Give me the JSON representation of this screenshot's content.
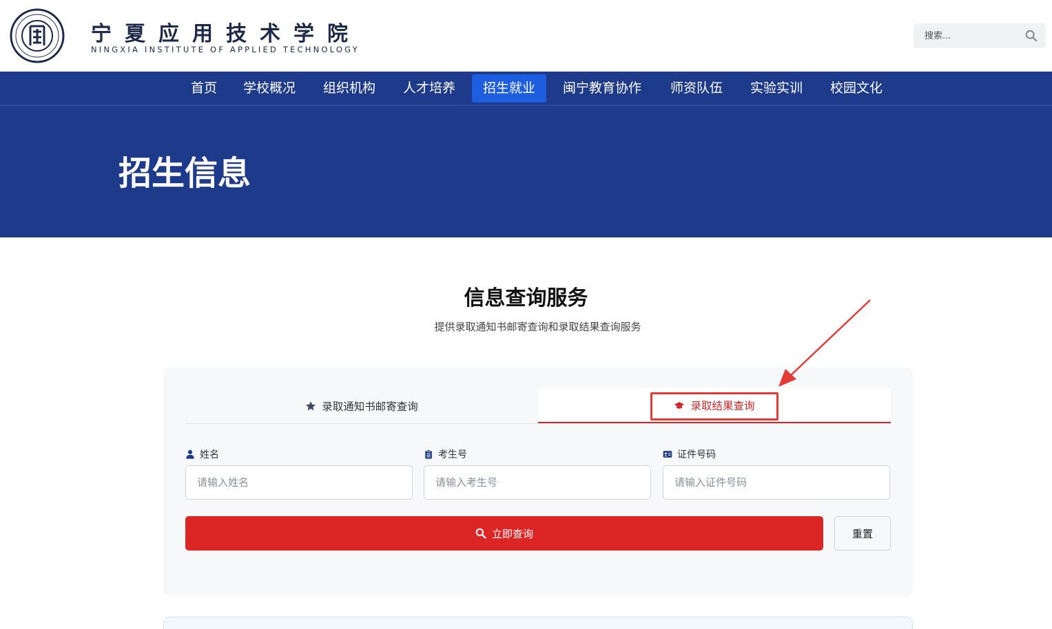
{
  "header": {
    "school_name": "宁夏应用技术学院",
    "school_name_en": "NINGXIA INSTITUTE OF APPLIED TECHNOLOGY",
    "logo_icon": "school-seal-logo",
    "search": {
      "placeholder": "搜索...",
      "icon": "search-icon"
    }
  },
  "nav": {
    "items": [
      {
        "label": "首页"
      },
      {
        "label": "学校概况"
      },
      {
        "label": "组织机构"
      },
      {
        "label": "人才培养"
      },
      {
        "label": "招生就业",
        "active": true
      },
      {
        "label": "闽宁教育协作"
      },
      {
        "label": "师资队伍"
      },
      {
        "label": "实验实训"
      },
      {
        "label": "校园文化"
      }
    ]
  },
  "banner": {
    "title": "招生信息"
  },
  "section": {
    "title": "信息查询服务",
    "subtitle": "提供录取通知书邮寄查询和录取结果查询服务"
  },
  "tabs": [
    {
      "label": "录取通知书邮寄查询",
      "icon": "star-icon",
      "active": false
    },
    {
      "label": "录取结果查询",
      "icon": "graduation-cap-icon",
      "active": true
    }
  ],
  "form": {
    "name": {
      "label": "姓名",
      "placeholder": "请输入姓名",
      "icon": "user-icon"
    },
    "exam_no": {
      "label": "考生号",
      "placeholder": "请输入考生号",
      "icon": "clipboard-icon"
    },
    "id_no": {
      "label": "证件号码",
      "placeholder": "请输入证件号码",
      "icon": "id-card-icon"
    },
    "submit_label": "立即查询",
    "reset_label": "重置"
  },
  "colors": {
    "primary_blue": "#1e3a8a",
    "active_nav": "#1d5ee0",
    "accent_red": "#dc2626",
    "annotation_red": "#e53935"
  }
}
